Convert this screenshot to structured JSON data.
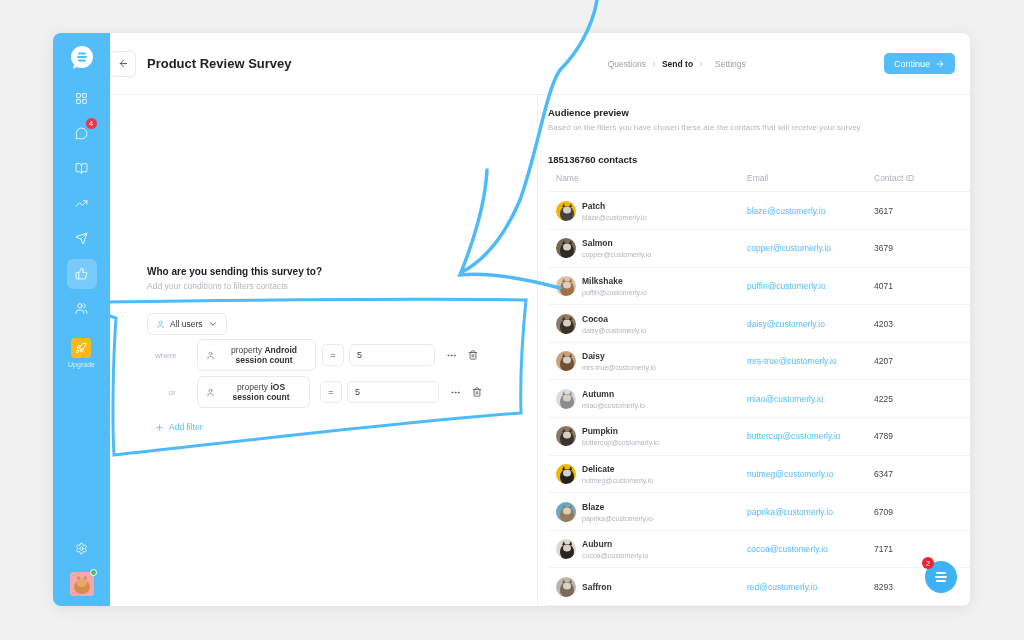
{
  "survey": {
    "title": "Product Review Survey"
  },
  "breadcrumb": [
    {
      "label": "Questions",
      "selected": false
    },
    {
      "label": "Send to",
      "selected": true
    },
    {
      "label": "Settings",
      "selected": false
    }
  ],
  "continue_button": {
    "label": "Continue"
  },
  "sidebar": {
    "items": [
      {
        "selected": false
      },
      {
        "selected": false,
        "badge": "4"
      },
      {
        "selected": false
      },
      {
        "selected": false
      },
      {
        "selected": false
      },
      {
        "selected": true
      },
      {
        "selected": false
      }
    ],
    "upgrade": {
      "label": "Upgrade"
    }
  },
  "audience": {
    "question": "Who are you sending this survey to?",
    "hint": "Add your conditions to filters contacts",
    "segment": "All users",
    "filters": [
      {
        "connector": "where",
        "property": "property **Android session count**",
        "operator": "=",
        "value": "5"
      },
      {
        "connector": "or",
        "property": "property **iOS session count**",
        "operator": "=",
        "value": "5"
      }
    ],
    "add_filter": "Add filter"
  },
  "preview": {
    "title": "Audience preview",
    "subtitle": "Based on the filters you have chosen these are the contacts that will receive your survey.",
    "count": "185136760 contacts",
    "columns": [
      "Name",
      "Email",
      "Contact ID"
    ],
    "rows": [
      {
        "name": "Patch",
        "sub": "blaze@customerly.io",
        "email": "blaze@customerly.io",
        "id": "3617"
      },
      {
        "name": "Salmon",
        "sub": "copper@customerly.io",
        "email": "copper@customerly.io",
        "id": "3679"
      },
      {
        "name": "Milkshake",
        "sub": "puffin@customerly.io",
        "email": "puffin@customerly.io",
        "id": "4071"
      },
      {
        "name": "Cocoa",
        "sub": "daisy@customerly.io",
        "email": "daisy@customerly.io",
        "id": "4203"
      },
      {
        "name": "Daisy",
        "sub": "mrs-true@customerly.io",
        "email": "mrs-true@customerly.io",
        "id": "4207"
      },
      {
        "name": "Autumn",
        "sub": "miao@customerly.io",
        "email": "miao@customerly.io",
        "id": "4225"
      },
      {
        "name": "Pumpkin",
        "sub": "buttercup@customerly.io",
        "email": "buttercup@customerly.io",
        "id": "4789"
      },
      {
        "name": "Delicate",
        "sub": "nutmeg@customerly.io",
        "email": "nutmeg@customerly.io",
        "id": "6347"
      },
      {
        "name": "Blaze",
        "sub": "paprika@customerly.io",
        "email": "paprika@customerly.io",
        "id": "6709"
      },
      {
        "name": "Auburn",
        "sub": "cocoa@customerly.io",
        "email": "cocoa@customerly.io",
        "id": "7171"
      },
      {
        "name": "Saffron",
        "email": "red@customerly.io",
        "id": "8293"
      }
    ]
  },
  "chat_launcher": {
    "badge": "2"
  }
}
